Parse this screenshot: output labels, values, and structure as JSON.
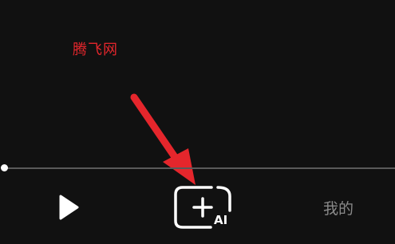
{
  "watermark": {
    "text": "腾飞网",
    "color": "#e5262c"
  },
  "player": {
    "progress_fraction": 0.0
  },
  "bottom_nav": {
    "play_icon": "play-icon",
    "ai_create_icon": "plus-in-rounded-square-icon",
    "ai_label": "AI",
    "me_label": "我的"
  },
  "colors": {
    "background": "#111111",
    "accent_arrow": "#e5262c",
    "inactive_text": "#8a8a8a"
  }
}
